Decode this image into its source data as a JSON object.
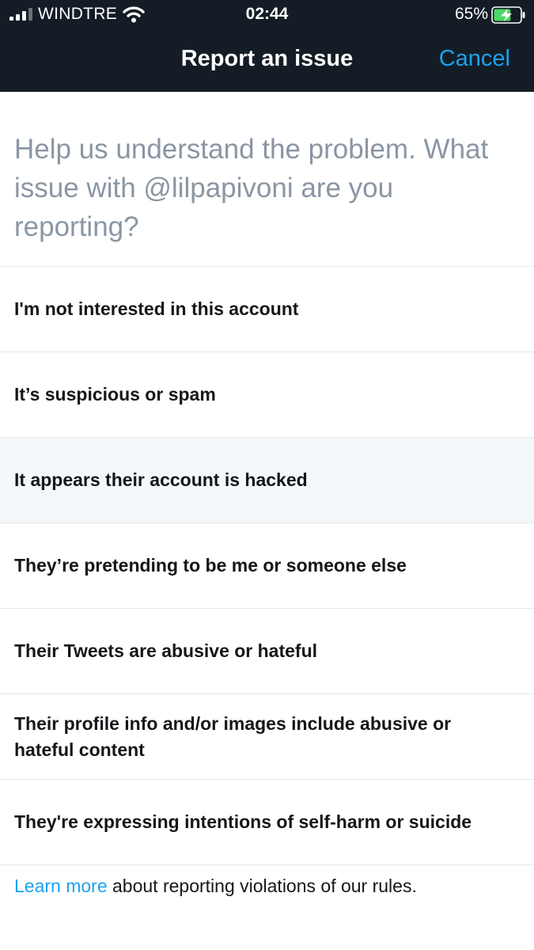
{
  "status_bar": {
    "carrier": "WINDTRE",
    "time": "02:44",
    "battery_percent": "65%",
    "battery_level": 0.65,
    "icons": [
      "cellular-signal-icon",
      "wifi-icon",
      "battery-charging-icon"
    ]
  },
  "header": {
    "title": "Report an issue",
    "cancel_label": "Cancel"
  },
  "prompt": "Help us understand the problem. What issue with @lilpapivoni are you reporting?",
  "options": [
    "I'm not interested in this account",
    "It’s suspicious or spam",
    "It appears their account is hacked",
    "They’re pretending to be me or someone else",
    "Their Tweets are abusive or hateful",
    "Their profile info and/or images include abusive or hateful content",
    "They're expressing intentions of self-harm or suicide"
  ],
  "footer": {
    "link_text": "Learn more",
    "text": " about reporting violations of our rules."
  },
  "colors": {
    "header_bg": "#141d26",
    "accent": "#1da1f2",
    "prompt_text": "#8a96a3",
    "divider": "#e1e8ed",
    "highlight_row": "#f5f8fa",
    "battery_fill": "#4cd964"
  }
}
